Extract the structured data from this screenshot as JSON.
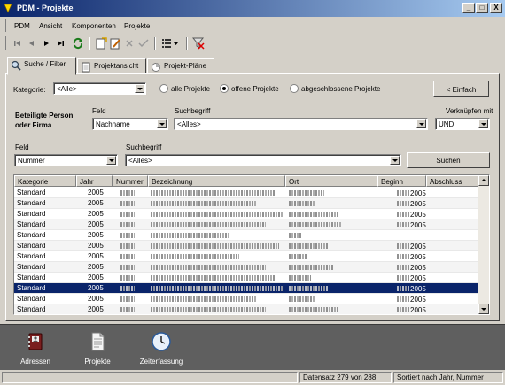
{
  "window": {
    "title": "PDM - Projekte",
    "minimize": "_",
    "maximize": "□",
    "close": "X"
  },
  "menu": [
    "PDM",
    "Ansicht",
    "Komponenten",
    "Projekte"
  ],
  "toolbar": [
    "first-icon",
    "prev-icon",
    "next-icon",
    "last-icon",
    "refresh-icon",
    "new-icon",
    "edit-icon",
    "delete-icon",
    "apply-icon",
    "list-icon",
    "filter-off-icon"
  ],
  "tabs": [
    "Suche / Filter",
    "Projektansicht",
    "Projekt-Pläne"
  ],
  "filter": {
    "kategorie_label": "Kategorie:",
    "kategorie_value": "<Alle>",
    "radios": [
      "alle Projekte",
      "offene Projekte",
      "abgeschlossene Projekte"
    ],
    "radio_selected": 1,
    "einfach_button": "< Einfach",
    "beteiligte_label_1": "Beteiligte Person",
    "beteiligte_label_2": "oder Firma",
    "feld_label": "Feld",
    "feld_value": "Nachname",
    "suchbegriff_label": "Suchbegriff",
    "suchbegriff_value": "<Alles>",
    "verknuepfen_label": "Verknüpfen mit",
    "verknuepfen_value": "UND",
    "feld2_label": "Feld",
    "feld2_value": "Nummer",
    "suchbegriff2_label": "Suchbegriff",
    "suchbegriff2_value": "<Alles>",
    "search_button": "Suchen"
  },
  "grid": {
    "columns": [
      "Kategorie",
      "Jahr",
      "Nummer",
      "Bezeichnung",
      "Ort",
      "Beginn",
      "Abschluss"
    ],
    "rows": [
      {
        "kategorie": "Standard",
        "jahr": "2005",
        "beginn": "2005"
      },
      {
        "kategorie": "Standard",
        "jahr": "2005",
        "beginn": "2005"
      },
      {
        "kategorie": "Standard",
        "jahr": "2005",
        "beginn": "2005"
      },
      {
        "kategorie": "Standard",
        "jahr": "2005",
        "beginn": "2005"
      },
      {
        "kategorie": "Standard",
        "jahr": "2005",
        "beginn": ""
      },
      {
        "kategorie": "Standard",
        "jahr": "2005",
        "beginn": "2005"
      },
      {
        "kategorie": "Standard",
        "jahr": "2005",
        "beginn": "2005"
      },
      {
        "kategorie": "Standard",
        "jahr": "2005",
        "beginn": "2005"
      },
      {
        "kategorie": "Standard",
        "jahr": "2005",
        "beginn": "2005"
      },
      {
        "kategorie": "Standard",
        "jahr": "2005",
        "beginn": "2005"
      },
      {
        "kategorie": "Standard",
        "jahr": "2005",
        "beginn": "2005"
      },
      {
        "kategorie": "Standard",
        "jahr": "2005",
        "beginn": "2005"
      }
    ],
    "selected_row": 9
  },
  "bottom_nav": [
    "Adressen",
    "Projekte",
    "Zeiterfassung"
  ],
  "status": {
    "record": "Datensatz 279 von 288",
    "sort": "Sortiert nach Jahr, Nummer"
  }
}
